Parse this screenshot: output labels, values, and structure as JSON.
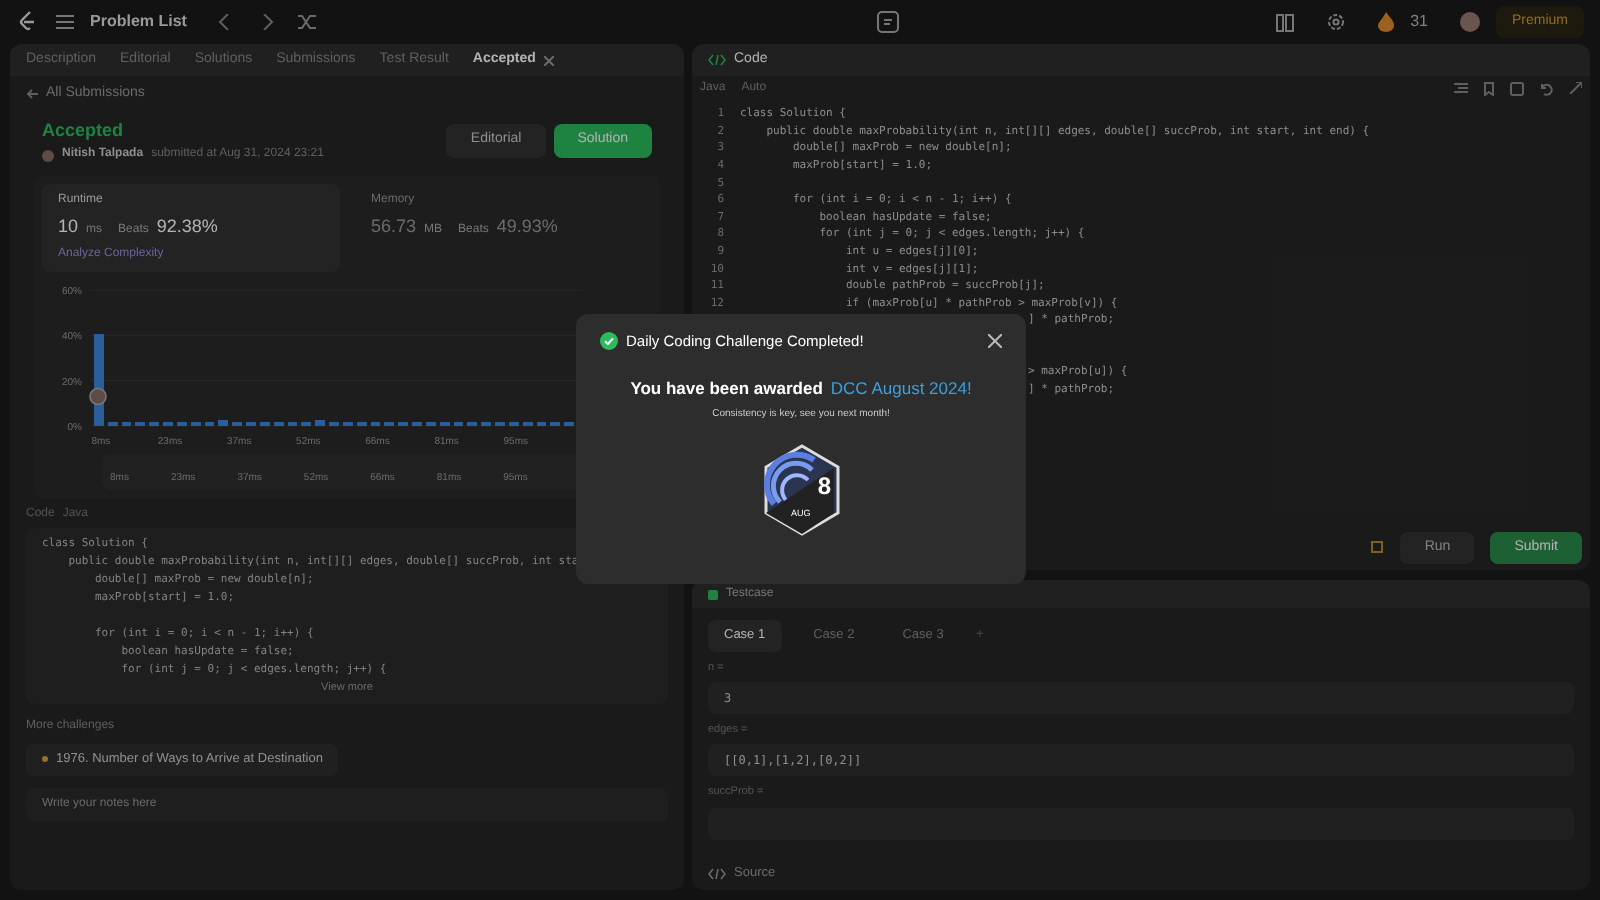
{
  "topbar": {
    "title": "Problem List",
    "streak": "31",
    "premium": "Premium"
  },
  "left_tabs": [
    {
      "label": "Description",
      "selected": false
    },
    {
      "label": "Editorial",
      "selected": false
    },
    {
      "label": "Solutions",
      "selected": false
    },
    {
      "label": "Submissions",
      "selected": false
    },
    {
      "label": "Test Result",
      "selected": false
    },
    {
      "label": "Accepted",
      "selected": true
    }
  ],
  "back_link": "All Submissions",
  "submission": {
    "status": "Accepted",
    "author": "Nitish Talpada",
    "submitted": "submitted at Aug 31, 2024 23:21",
    "buttons": [
      "Editorial",
      "Solution"
    ]
  },
  "runtime": {
    "title": "Runtime",
    "value": "10",
    "unit": "ms",
    "beats_label": "Beats",
    "beats": "92.38%",
    "link": "Analyze Complexity",
    "selected": true
  },
  "memory": {
    "title": "Memory",
    "value": "56.73",
    "unit": "MB",
    "beats_label": "Beats",
    "beats": "49.93%",
    "selected": false
  },
  "chart_data": {
    "type": "bar",
    "ylim": [
      0,
      60
    ],
    "yticks": [
      {
        "value": 0,
        "label": "0%"
      },
      {
        "value": 20,
        "label": "20%"
      },
      {
        "value": 40,
        "label": "40%"
      },
      {
        "value": 60,
        "label": "60%"
      }
    ],
    "categories": [
      "8ms",
      null,
      null,
      null,
      null,
      "23ms",
      null,
      null,
      null,
      null,
      "37ms",
      null,
      null,
      null,
      null,
      "52ms",
      null,
      null,
      null,
      null,
      "66ms",
      null,
      null,
      null,
      null,
      "81ms",
      null,
      null,
      null,
      null,
      "95ms",
      null,
      null,
      null,
      null
    ],
    "values": [
      40,
      1,
      1,
      1,
      1,
      1,
      1,
      1,
      1,
      2,
      1,
      1,
      1,
      1,
      1,
      1,
      2,
      1,
      1,
      1,
      1,
      1,
      1,
      1,
      1,
      1,
      1,
      1,
      1,
      1,
      1,
      1,
      1,
      1,
      1
    ]
  },
  "navigator_labels": [
    "8ms",
    "23ms",
    "37ms",
    "52ms",
    "66ms",
    "81ms",
    "95ms"
  ],
  "left_code": {
    "label": "Code",
    "language": "Java",
    "lines": [
      {
        "kind": "code",
        "text": "class Solution {"
      },
      {
        "kind": "code",
        "text": "    public double maxProbability(int n, int[][] edges, double[] succProb, int sta"
      },
      {
        "kind": "code",
        "text": "        double[] maxProb = new double[n];"
      },
      {
        "kind": "code",
        "text": "        maxProb[start] = 1.0;"
      },
      {
        "kind": "blank"
      },
      {
        "kind": "code",
        "text": "        for (int i = 0; i < n - 1; i++) {"
      },
      {
        "kind": "code",
        "text": "            boolean hasUpdate = false;"
      },
      {
        "kind": "code",
        "text": "            for (int j = 0; j < edges.length; j++) {"
      }
    ],
    "view_more": "View more"
  },
  "more_challenges": {
    "title": "More challenges",
    "items": [
      "1976. Number of Ways to Arrive at Destination"
    ]
  },
  "notes": {
    "placeholder": "Write your notes here"
  },
  "editor": {
    "title": "Code",
    "language": "Java",
    "mode": "Auto",
    "lines": [
      {
        "num": "1",
        "text": "class Solution {",
        "kind": "full"
      },
      {
        "num": "2",
        "text": "    public double maxProbability(int n, int[][] edges, double[] succProb, int start, int end) {",
        "kind": "full"
      },
      {
        "num": "3",
        "text": "        double[] maxProb = new double[n];",
        "kind": "full"
      },
      {
        "num": "4",
        "text": "        maxProb[start] = 1.0;",
        "kind": "full"
      },
      {
        "num": "5",
        "kind": "full"
      },
      {
        "num": "6",
        "text": "        for (int i = 0; i < n - 1; i++) {",
        "kind": "full"
      },
      {
        "num": "7",
        "text": "            boolean hasUpdate = false;",
        "kind": "full"
      },
      {
        "num": "8",
        "text": "            for (int j = 0; j < edges.length; j++) {",
        "kind": "full"
      },
      {
        "num": "9",
        "text": "                int u = edges[j][0];",
        "kind": "full"
      },
      {
        "num": "10",
        "text": "                int v = edges[j][1];",
        "kind": "full"
      },
      {
        "num": "11",
        "text": "                double pathProb = succProb[j];",
        "kind": "full"
      },
      {
        "num": "12",
        "text": "                if (maxProb[u] * pathProb > maxProb[v]) {",
        "kind": "full"
      },
      {
        "text": "] * pathProb;",
        "kind": "tail"
      },
      {
        "kind": "tail"
      },
      {
        "kind": "tail"
      },
      {
        "text": "> maxProb[u]) {",
        "kind": "tail"
      },
      {
        "text": "] * pathProb;",
        "kind": "tail"
      }
    ],
    "run": "Run",
    "submit": "Submit"
  },
  "testcase": {
    "title": "Testcase",
    "cases": [
      {
        "label": "Case 1",
        "selected": true
      },
      {
        "label": "Case 2",
        "selected": false
      },
      {
        "label": "Case 3",
        "selected": false
      }
    ],
    "add": "+",
    "fields": [
      {
        "label": "n =",
        "value": "3"
      },
      {
        "label": "edges =",
        "value": "[[0,1],[1,2],[0,2]]"
      },
      {
        "label": "succProb ="
      }
    ],
    "source": "Source"
  },
  "modal": {
    "title": "Daily Coding Challenge Completed!",
    "message": "You have been awarded",
    "award": "DCC August 2024!",
    "subtitle": "Consistency is key, see you next month!",
    "badge_day": "8",
    "badge_month": "AUG"
  }
}
